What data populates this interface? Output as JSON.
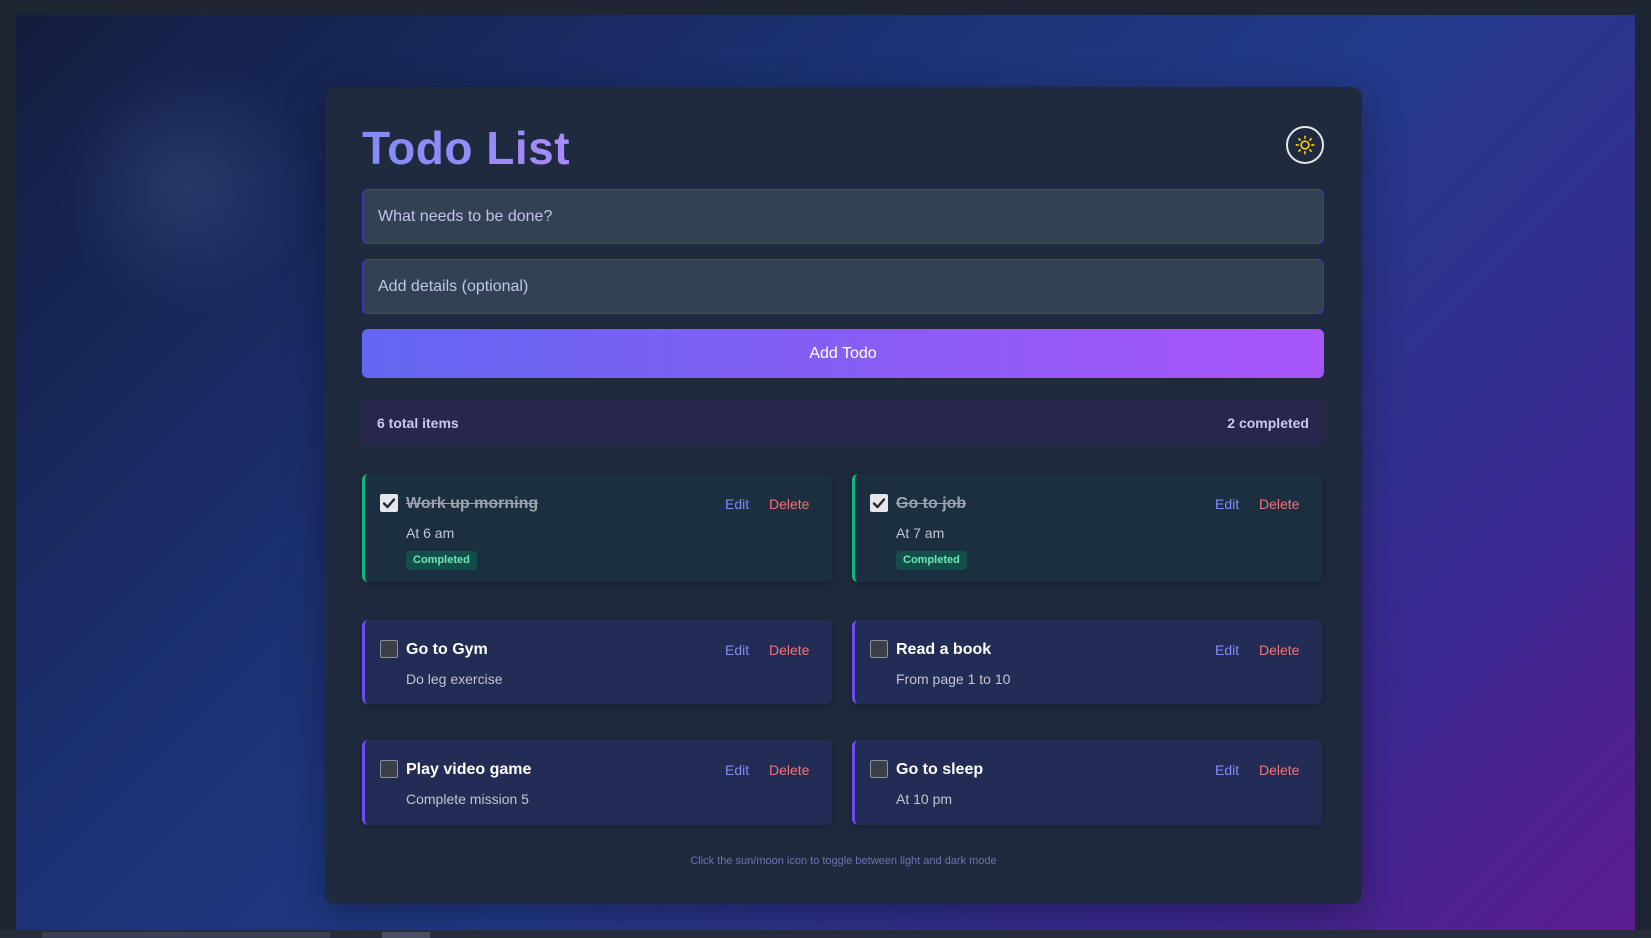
{
  "app": {
    "title": "Todo List",
    "theme_toggle_icon": "sun-icon"
  },
  "form": {
    "todo_placeholder": "What needs to be done?",
    "details_placeholder": "Add details (optional)",
    "add_button_label": "Add Todo"
  },
  "stats": {
    "total": "6 total items",
    "completed": "2 completed"
  },
  "todos": [
    {
      "title": "Work up morning",
      "details": "At 6 am",
      "completed": true,
      "badge": "Completed",
      "edit": "Edit",
      "delete": "Delete"
    },
    {
      "title": "Go to job",
      "details": "At 7 am",
      "completed": true,
      "badge": "Completed",
      "edit": "Edit",
      "delete": "Delete"
    },
    {
      "title": "Go to Gym",
      "details": "Do leg exercise",
      "completed": false,
      "edit": "Edit",
      "delete": "Delete"
    },
    {
      "title": "Read a book",
      "details": "From page 1 to 10",
      "completed": false,
      "edit": "Edit",
      "delete": "Delete"
    },
    {
      "title": "Play video game",
      "details": "Complete mission 5",
      "completed": false,
      "edit": "Edit",
      "delete": "Delete"
    },
    {
      "title": "Go to sleep",
      "details": "At 10 pm",
      "completed": false,
      "edit": "Edit",
      "delete": "Delete"
    }
  ],
  "footer": {
    "hint": "Click the sun/moon icon to toggle between light and dark mode"
  },
  "colors": {
    "accent": "#6366f1",
    "accent_end": "#a855f7",
    "completed": "#10b981",
    "delete": "#f87171",
    "edit": "#818cf8"
  }
}
